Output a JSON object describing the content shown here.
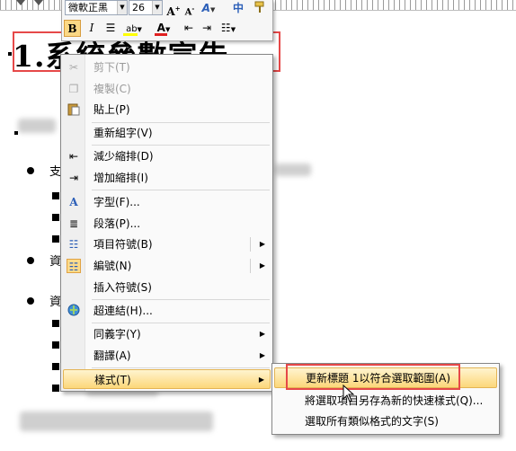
{
  "document": {
    "heading": "1.系統參數宣告",
    "body_chars": [
      "支",
      "資",
      "資"
    ]
  },
  "mini_toolbar": {
    "font_name": "微軟正黑",
    "font_size": "26",
    "bold": "B",
    "italic": "I",
    "grow_font": "A",
    "shrink_font": "A",
    "font_color": "A",
    "cjk_button": "中"
  },
  "context_menu": {
    "items": [
      {
        "label": "剪下(T)",
        "icon": "scissors-icon",
        "disabled": true
      },
      {
        "label": "複製(C)",
        "icon": "copy-icon",
        "disabled": true
      },
      {
        "label": "貼上(P)",
        "icon": "paste-icon"
      },
      {
        "label": "重新組字(V)",
        "icon": ""
      },
      {
        "label": "減少縮排(D)",
        "icon": "decrease-indent-icon"
      },
      {
        "label": "增加縮排(I)",
        "icon": "increase-indent-icon"
      },
      {
        "label": "字型(F)...",
        "icon": "font-icon"
      },
      {
        "label": "段落(P)...",
        "icon": "paragraph-icon"
      },
      {
        "label": "項目符號(B)",
        "icon": "bullets-icon",
        "submenu": true
      },
      {
        "label": "編號(N)",
        "icon": "numbering-icon",
        "submenu": true,
        "checked": true
      },
      {
        "label": "插入符號(S)",
        "icon": ""
      },
      {
        "label": "超連結(H)...",
        "icon": "hyperlink-icon"
      },
      {
        "label": "同義字(Y)",
        "icon": "",
        "submenu": true
      },
      {
        "label": "翻譯(A)",
        "icon": "",
        "submenu": true
      },
      {
        "label": "樣式(T)",
        "icon": "",
        "submenu": true,
        "selected": true
      }
    ]
  },
  "styles_submenu": {
    "items": [
      {
        "label": "更新標題 1以符合選取範圍(A)",
        "selected": true
      },
      {
        "label": "將選取項目另存為新的快速樣式(Q)..."
      },
      {
        "label": "選取所有類似格式的文字(S)"
      }
    ]
  },
  "colors": {
    "highlight_border": "#e64848",
    "hover_fill": "#fcd77a",
    "font_color_bar": "#e02020",
    "highlight_color_bar": "#ffff00"
  }
}
